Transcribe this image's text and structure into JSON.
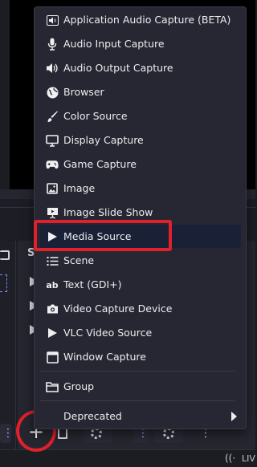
{
  "menu": {
    "items": [
      {
        "label": "Application Audio Capture (BETA)",
        "icon": "speaker-icon"
      },
      {
        "label": "Audio Input Capture",
        "icon": "microphone-icon"
      },
      {
        "label": "Audio Output Capture",
        "icon": "speaker-icon"
      },
      {
        "label": "Browser",
        "icon": "globe-icon"
      },
      {
        "label": "Color Source",
        "icon": "paint-brush-icon"
      },
      {
        "label": "Display Capture",
        "icon": "monitor-icon"
      },
      {
        "label": "Game Capture",
        "icon": "gamepad-icon"
      },
      {
        "label": "Image",
        "icon": "image-icon"
      },
      {
        "label": "Image Slide Show",
        "icon": "slideshow-icon"
      },
      {
        "label": "Media Source",
        "icon": "play-icon"
      },
      {
        "label": "Scene",
        "icon": "list-icon"
      },
      {
        "label": "Text (GDI+)",
        "icon": "text-icon"
      },
      {
        "label": "Video Capture Device",
        "icon": "camera-icon"
      },
      {
        "label": "VLC Video Source",
        "icon": "play-icon"
      },
      {
        "label": "Window Capture",
        "icon": "window-icon"
      }
    ],
    "group_label": "Group",
    "deprecated_label": "Deprecated",
    "highlighted_item": "Media Source"
  },
  "sources_panel": {
    "title_fragment": "So"
  },
  "toolbar": {
    "add_symbol": "+"
  },
  "statusbar": {
    "live_fragment": "LIV"
  },
  "colors": {
    "highlight_bg": "#1a2035",
    "annotation_red": "#e0202a",
    "menu_bg": "#272733"
  }
}
